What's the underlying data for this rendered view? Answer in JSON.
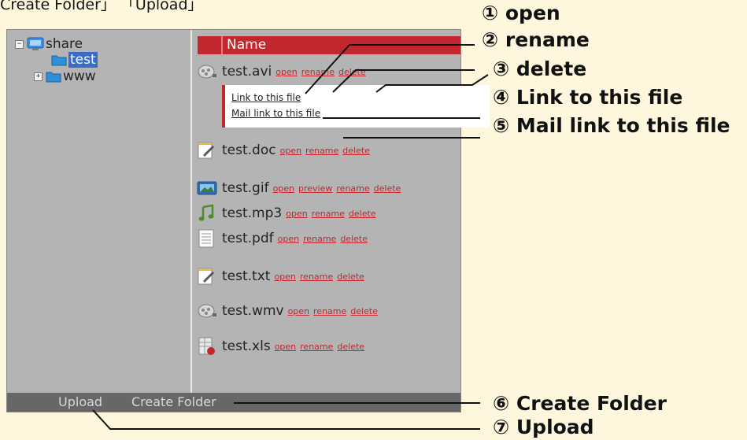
{
  "top_caption": "Create Folder」 「Upload」",
  "tree": {
    "root": {
      "label": "share",
      "toggle": "−"
    },
    "child_selected": {
      "label": "test"
    },
    "child_collapsed": {
      "label": "www",
      "toggle": "+"
    }
  },
  "header": {
    "name_label": "Name"
  },
  "files": [
    {
      "name": "test.avi",
      "icon": "video-reel-icon",
      "actions": [
        "open",
        "rename",
        "delete"
      ]
    },
    {
      "name": "test.doc",
      "icon": "document-edit-icon",
      "actions": [
        "open",
        "rename",
        "delete"
      ]
    },
    {
      "name": "test.gif",
      "icon": "image-icon",
      "actions": [
        "open",
        "preview",
        "rename",
        "delete"
      ]
    },
    {
      "name": "test.mp3",
      "icon": "music-note-icon",
      "actions": [
        "open",
        "rename",
        "delete"
      ]
    },
    {
      "name": "test.pdf",
      "icon": "text-lines-icon",
      "actions": [
        "open",
        "rename",
        "delete"
      ]
    },
    {
      "name": "test.txt",
      "icon": "document-edit-icon",
      "actions": [
        "open",
        "rename",
        "delete"
      ]
    },
    {
      "name": "test.wmv",
      "icon": "video-reel-icon",
      "actions": [
        "open",
        "rename",
        "delete"
      ]
    },
    {
      "name": "test.xls",
      "icon": "spreadsheet-icon",
      "actions": [
        "open",
        "rename",
        "delete"
      ]
    }
  ],
  "link_popup": {
    "link": "Link to this file",
    "mail": "Mail link to this file"
  },
  "bottom_bar": {
    "upload": "Upload",
    "create_folder": "Create Folder"
  },
  "callouts": {
    "c1": "① open",
    "c2": "② rename",
    "c3": "③ delete",
    "c4": "④ Link to this file",
    "c5": "⑤ Mail link to this file",
    "c6": "⑥ Create Folder",
    "c7": "⑦ Upload"
  },
  "colors": {
    "accent": "#c1272d",
    "pane_bg": "#b4b4b4",
    "page_bg": "#fef7dd",
    "bar_bg": "#676767"
  }
}
